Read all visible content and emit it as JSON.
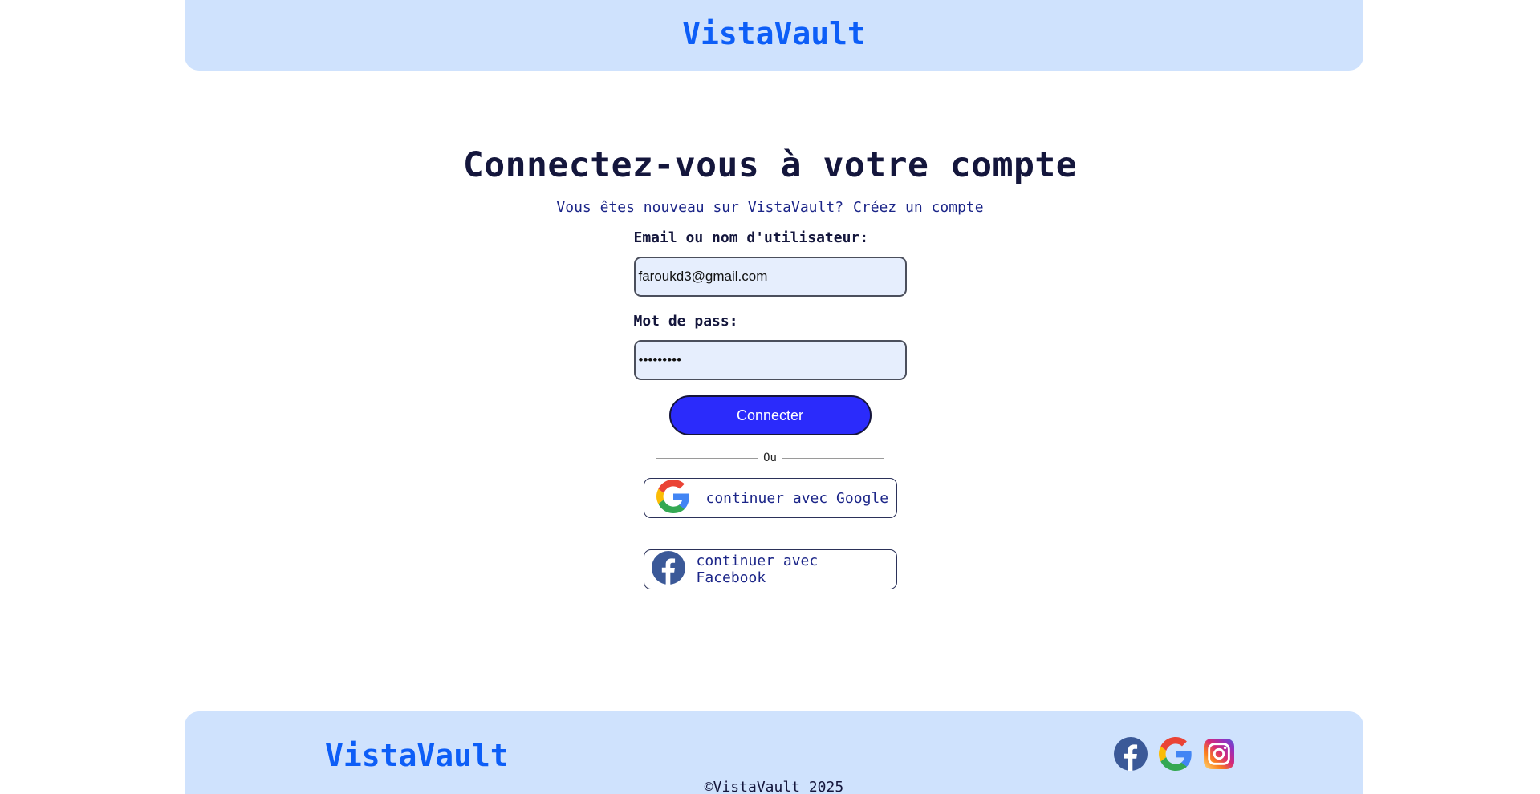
{
  "header": {
    "brand": "VistaVault"
  },
  "main": {
    "title": "Connectez-vous à votre compte",
    "signup_prompt": "Vous êtes nouveau sur VistaVault?",
    "signup_link": "Créez un compte"
  },
  "form": {
    "email_label": "Email ou nom d'utilisateur:",
    "email_value": "faroukd3@gmail.com",
    "password_label": "Mot de pass:",
    "password_value": "•••••••••",
    "submit_label": "Connecter",
    "divider_text": "Ou"
  },
  "social": {
    "google_label": "continuer avec Google",
    "facebook_label": "continuer avec Facebook"
  },
  "footer": {
    "brand": "VistaVault",
    "copyright": "©VistaVault_2025",
    "icons": [
      "facebook-icon",
      "google-icon",
      "instagram-icon"
    ]
  },
  "colors": {
    "header_bg": "#cfe2fd",
    "brand": "#0d5ef7",
    "primary_button": "#2b2bfb",
    "input_bg": "#e6eefd",
    "facebook": "#3b5998"
  }
}
